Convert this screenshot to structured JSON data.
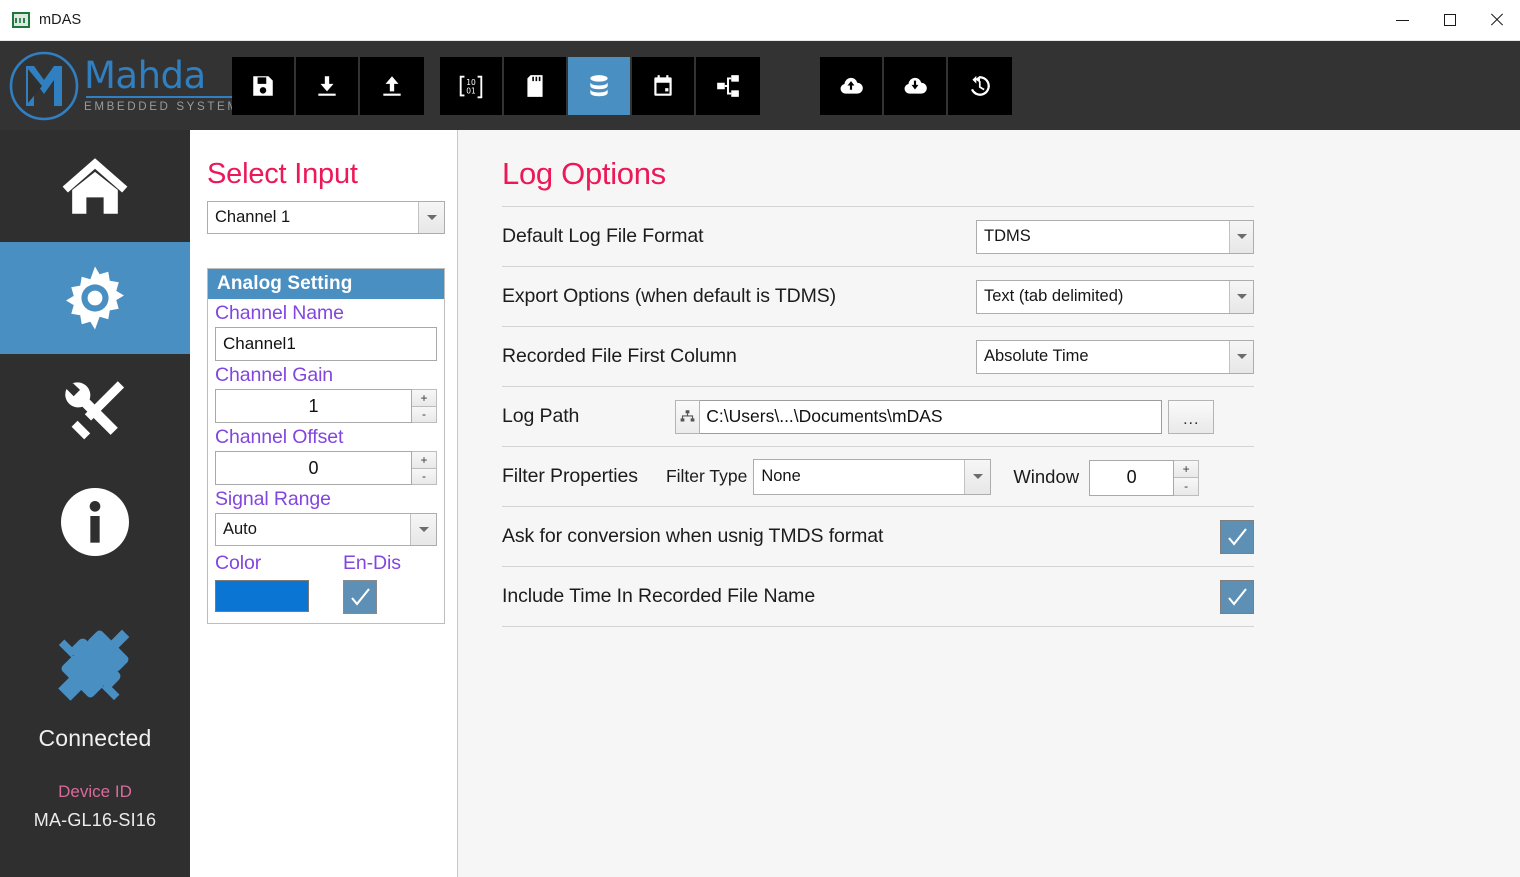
{
  "window": {
    "title": "mDAS",
    "app_icon": "chart-app-icon",
    "minimize": "minimize-icon",
    "maximize": "maximize-icon",
    "close": "close-icon"
  },
  "brand": {
    "name": "Mahda",
    "tagline": "EMBEDDED SYSTEMS",
    "logo": "mahda-m-logo"
  },
  "toolbar": {
    "groups": [
      {
        "name": "file-group",
        "buttons": [
          {
            "icon": "save-floppy-icon",
            "active": false
          },
          {
            "icon": "download-icon",
            "active": false
          },
          {
            "icon": "upload-icon",
            "active": false
          }
        ]
      },
      {
        "name": "data-group",
        "buttons": [
          {
            "icon": "binary-matrix-icon",
            "active": false
          },
          {
            "icon": "sd-card-icon",
            "active": false
          },
          {
            "icon": "database-icon",
            "active": true
          },
          {
            "icon": "calendar-icon",
            "active": false
          },
          {
            "icon": "network-tree-icon",
            "active": false
          }
        ]
      },
      {
        "name": "cloud-group",
        "buttons": [
          {
            "icon": "cloud-upload-icon",
            "active": false
          },
          {
            "icon": "cloud-download-icon",
            "active": false
          },
          {
            "icon": "history-restore-icon",
            "active": false
          }
        ]
      }
    ]
  },
  "sidebar": {
    "items": [
      {
        "icon": "home-icon",
        "name": "sidebar-item-home",
        "active": false
      },
      {
        "icon": "gear-icon",
        "name": "sidebar-item-settings",
        "active": true
      },
      {
        "icon": "tools-icon",
        "name": "sidebar-item-tools",
        "active": false
      },
      {
        "icon": "info-icon",
        "name": "sidebar-item-info",
        "active": false
      }
    ],
    "status": {
      "icon": "plug-connected-icon",
      "text": "Connected",
      "device_id_label": "Device ID",
      "device_id_value": "MA-GL16-SI16"
    }
  },
  "select_input": {
    "title": "Select Input",
    "channel": "Channel 1"
  },
  "analog_setting": {
    "header": "Analog Setting",
    "channel_name_label": "Channel Name",
    "channel_name_value": "Channel1",
    "channel_gain_label": "Channel Gain",
    "channel_gain_value": "1",
    "channel_offset_label": "Channel Offset",
    "channel_offset_value": "0",
    "signal_range_label": "Signal Range",
    "signal_range_value": "Auto",
    "color_label": "Color",
    "color_value": "#0b75d4",
    "endis_label": "En-Dis",
    "endis_checked": true,
    "spinner_up": "+",
    "spinner_down": "-"
  },
  "log_options": {
    "title": "Log Options",
    "rows": {
      "default_format_label": "Default Log File Format",
      "default_format_value": "TDMS",
      "export_options_label": "Export Options (when default is TDMS)",
      "export_options_value": "Text (tab delimited)",
      "first_column_label": "Recorded File First Column",
      "first_column_value": "Absolute Time",
      "log_path_label": "Log Path",
      "log_path_value": "C:\\Users\\...\\Documents\\mDAS",
      "log_path_browse": "...",
      "filter_properties_label": "Filter Properties",
      "filter_type_label": "Filter Type",
      "filter_type_value": "None",
      "window_label": "Window",
      "window_value": "0",
      "ask_conversion_label": "Ask for conversion when usnig TMDS format",
      "ask_conversion_checked": true,
      "include_time_label": "Include Time In Recorded File Name",
      "include_time_checked": true
    }
  },
  "colors": {
    "accent_pink": "#ec1857",
    "accent_blue": "#4a8fc2",
    "label_purple": "#8246e0",
    "toolbar_bg": "#333333",
    "sidebar_bg": "#2f2f2f"
  }
}
